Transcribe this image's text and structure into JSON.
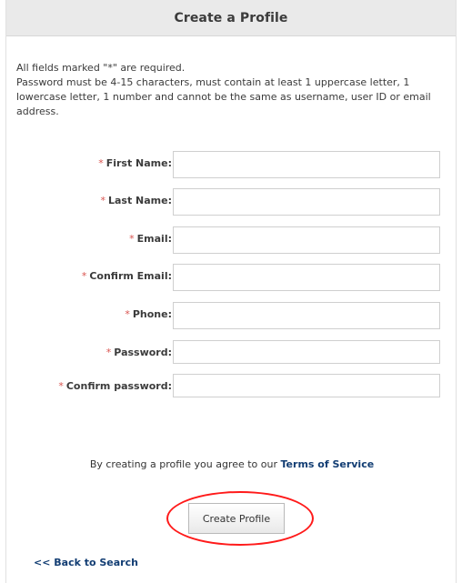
{
  "header": {
    "title": "Create a Profile"
  },
  "intro": {
    "required_note": "All fields marked \"*\" are required.",
    "password_rules": "Password must be 4-15 characters, must contain at least 1 uppercase letter, 1 lowercase letter, 1 number and cannot be the same as username, user ID or email address."
  },
  "form": {
    "required_marker": "*",
    "fields": [
      {
        "label": "First Name:",
        "value": "",
        "placeholder": ""
      },
      {
        "label": "Last Name:",
        "value": "",
        "placeholder": ""
      },
      {
        "label": "Email:",
        "value": "",
        "placeholder": ""
      },
      {
        "label": "Confirm Email:",
        "value": "",
        "placeholder": ""
      },
      {
        "label": "Phone:",
        "value": "",
        "placeholder": ""
      },
      {
        "label": "Password:",
        "value": "",
        "placeholder": ""
      },
      {
        "label": "Confirm password:",
        "value": "",
        "placeholder": ""
      }
    ]
  },
  "agreement": {
    "text": "By creating a profile you agree to our",
    "link_label": "Terms of Service"
  },
  "actions": {
    "create_profile_label": "Create Profile",
    "back_label": "<< Back to Search"
  },
  "colors": {
    "header_background": "#eaeaea",
    "required_star": "#d9534f",
    "link": "#123d73",
    "annotation": "#ff1a1a"
  }
}
